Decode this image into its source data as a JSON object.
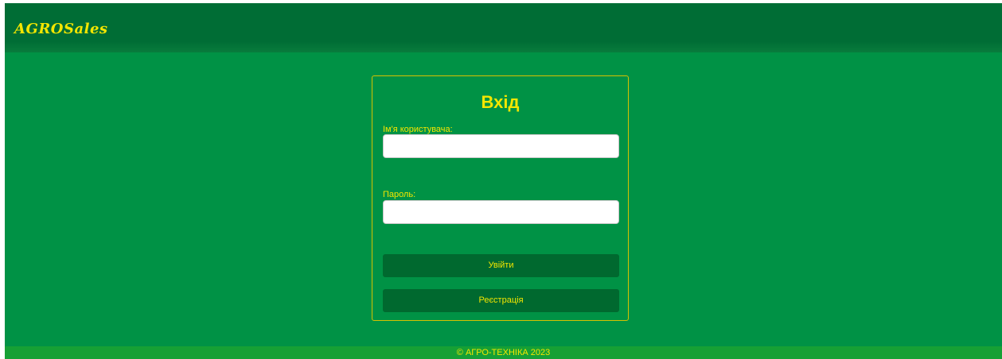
{
  "header": {
    "logo_text": "AGROSales"
  },
  "login": {
    "title": "Вхід",
    "username_label": "Ім'я користувача:",
    "username_value": "",
    "password_label": "Пароль:",
    "password_value": "",
    "submit_label": "Увійти",
    "register_label": "Реєстрація"
  },
  "footer": {
    "text": "© АГРО-ТЕХНІКА 2023"
  },
  "colors": {
    "background": "#009245",
    "header": "#006d35",
    "accent_text": "#f3e600",
    "button": "#00692f",
    "footer": "#16a035"
  }
}
